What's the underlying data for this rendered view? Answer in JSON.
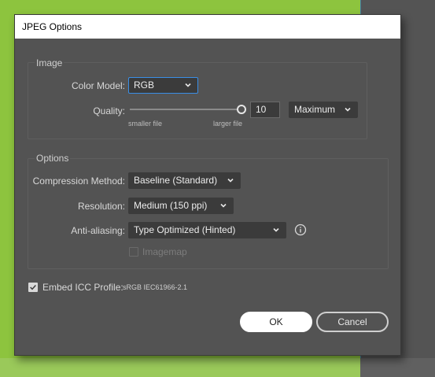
{
  "colors": {
    "background": "#8dc43e",
    "dialog": "#535353",
    "accent": "#3a8ee6"
  },
  "dialog": {
    "title": "JPEG Options"
  },
  "image_group": {
    "title": "Image",
    "color_model": {
      "label": "Color Model:",
      "value": "RGB"
    },
    "quality": {
      "label": "Quality:",
      "value": "10",
      "level": 1.0,
      "min_label": "smaller file",
      "max_label": "larger file",
      "preset": "Maximum"
    }
  },
  "options_group": {
    "title": "Options",
    "compression": {
      "label": "Compression Method:",
      "value": "Baseline (Standard)"
    },
    "resolution": {
      "label": "Resolution:",
      "value": "Medium (150 ppi)"
    },
    "antialiasing": {
      "label": "Anti-aliasing:",
      "value": "Type Optimized (Hinted)"
    },
    "imagemap": {
      "label": "Imagemap",
      "checked": false,
      "enabled": false
    }
  },
  "icc": {
    "label": "Embed ICC Profile:",
    "value": "sRGB IEC61966-2.1",
    "checked": true
  },
  "buttons": {
    "ok": "OK",
    "cancel": "Cancel"
  },
  "icons": {
    "dropdown": "chevron-down-icon",
    "info": "info-icon",
    "check": "checkmark-icon"
  }
}
